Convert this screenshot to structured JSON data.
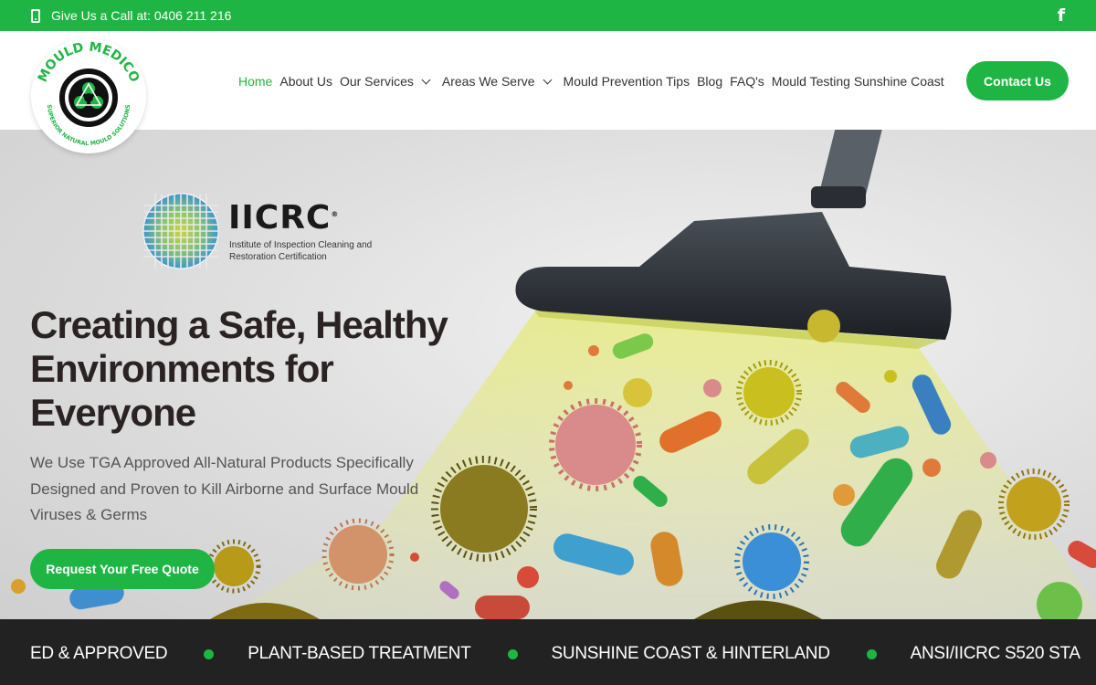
{
  "topbar": {
    "call_text": "Give Us a Call at: 0406 211 216",
    "facebook_glyph": "f"
  },
  "logo": {
    "name_arc": "MOULD MEDICO",
    "tagline_arc": "SUPERIOR NATURAL MOULD SOLUTIONS"
  },
  "nav": {
    "items": [
      {
        "label": "Home",
        "active": true
      },
      {
        "label": "About Us"
      },
      {
        "label": "Our Services",
        "dropdown": true
      },
      {
        "label": "Areas We Serve",
        "dropdown": true
      },
      {
        "label": "Mould Prevention Tips"
      },
      {
        "label": "Blog"
      },
      {
        "label": "FAQ's"
      },
      {
        "label": "Mould Testing Sunshine Coast"
      }
    ],
    "contact_label": "Contact Us"
  },
  "hero": {
    "cert_title": "IICRC",
    "cert_reg": "®",
    "cert_subtitle": "Institute of Inspection Cleaning and Restoration Certification",
    "title": "Creating a Safe, Healthy Environments for Everyone",
    "description": "We Use TGA Approved All-Natural Products Specifically Designed and Proven to Kill Airborne and Surface Mould Viruses & Germs",
    "cta_label": "Request Your Free Quote"
  },
  "ticker": {
    "items": [
      "ED & APPROVED",
      "PLANT-BASED TREATMENT",
      "SUNSHINE COAST & HINTERLAND",
      "ANSI/IICRC S520 STA"
    ]
  },
  "colors": {
    "brand_green": "#1fb544",
    "ticker_bg": "#222222",
    "heading": "#2b2323"
  }
}
